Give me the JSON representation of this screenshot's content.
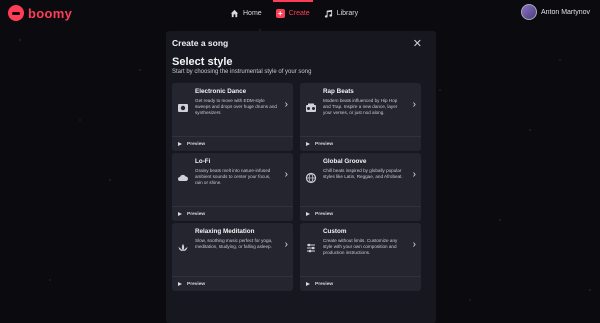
{
  "brand": {
    "name": "boomy",
    "accent": "#ff3d57"
  },
  "nav": {
    "items": [
      {
        "label": "Home",
        "icon": "home-icon"
      },
      {
        "label": "Create",
        "icon": "create-icon",
        "active": true
      },
      {
        "label": "Library",
        "icon": "music-note-icon"
      }
    ]
  },
  "user": {
    "name": "Anton Martynov",
    "icon": "avatar"
  },
  "modal": {
    "title": "Create a song",
    "close_icon": "close-icon",
    "section_title": "Select style",
    "section_subtitle": "Start by choosing the instrumental style of your song",
    "preview_label": "Preview",
    "cards": [
      {
        "title": "Electronic Dance",
        "desc": "Get ready to move with EDM-style sweeps and drops over huge drums and synthesizers",
        "icon": "speaker-icon"
      },
      {
        "title": "Rap Beats",
        "desc": "Modern beats influenced by Hip Hop and Trap. Inspire a new dance, layer your verses, or just nod along.",
        "icon": "boombox-icon"
      },
      {
        "title": "Lo-Fi",
        "desc": "Grainy beats melt into nature-infused ambient sounds to center your focus, rain or shine.",
        "icon": "cloud-icon"
      },
      {
        "title": "Global Groove",
        "desc": "Chill beats inspired by globally popular styles like Latin, Reggae, and Afrobeat.",
        "icon": "globe-icon"
      },
      {
        "title": "Relaxing Meditation",
        "desc": "Slow, soothing music perfect for yoga, meditation, studying, or falling asleep.",
        "icon": "lotus-icon"
      },
      {
        "title": "Custom",
        "desc": "Create without limits. Customize any style with your own composition and production instructions.",
        "icon": "sliders-icon"
      }
    ]
  }
}
